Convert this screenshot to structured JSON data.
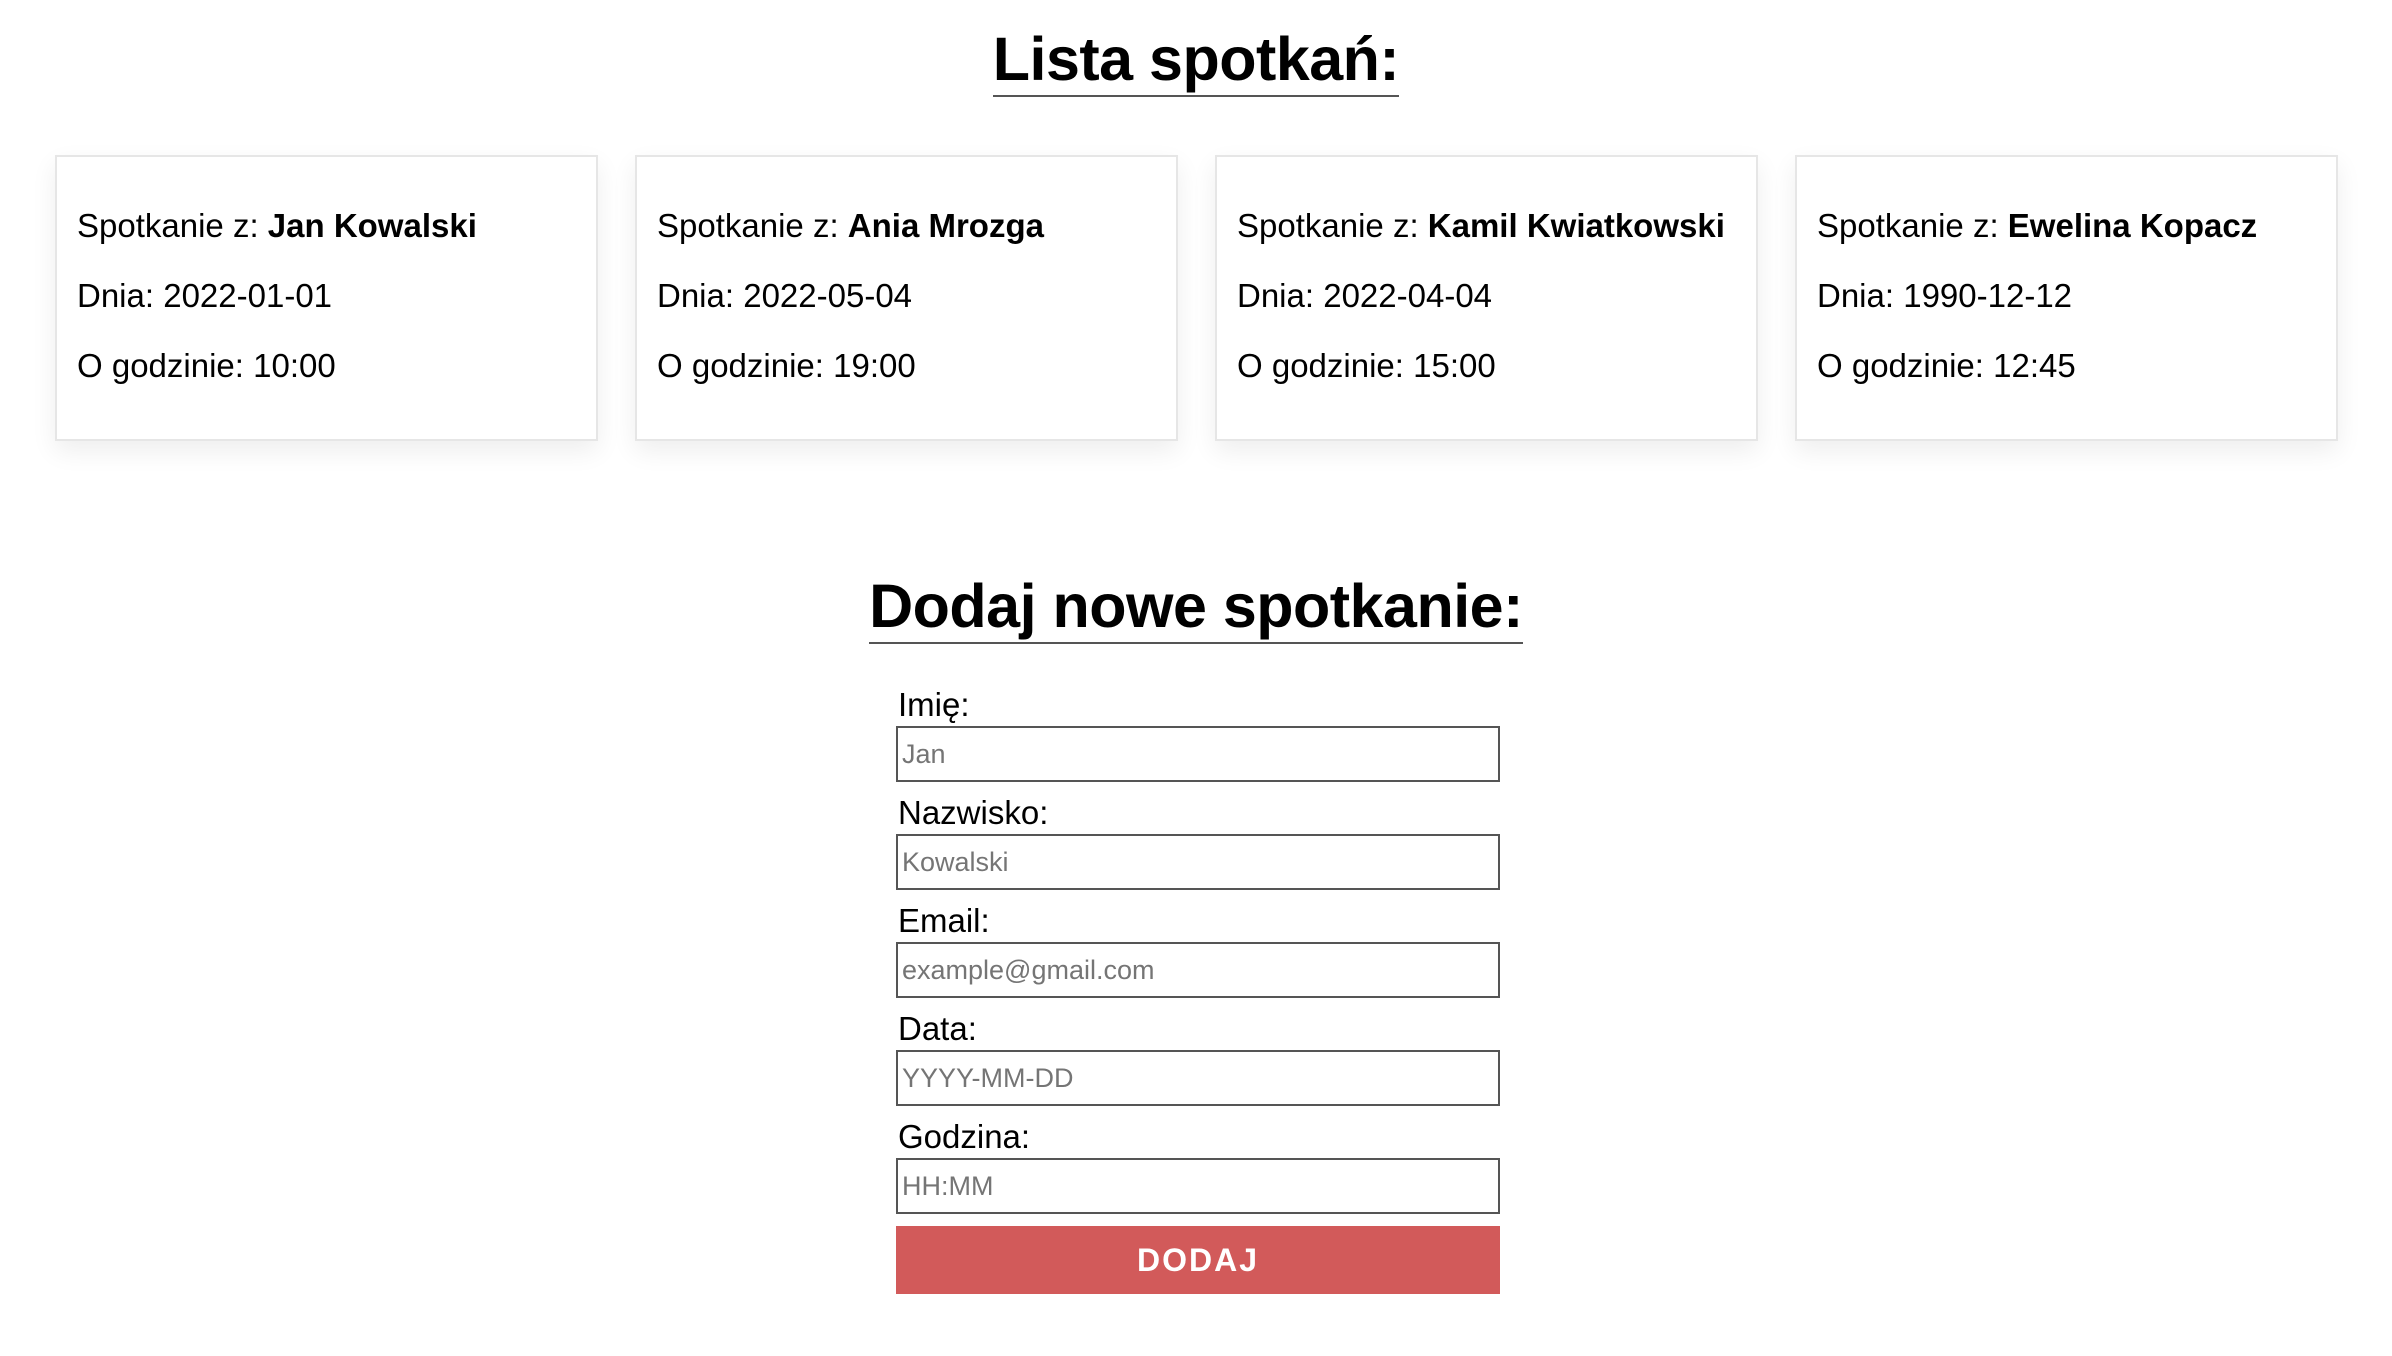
{
  "list_title": "Lista spotkań:",
  "meetings": [
    {
      "prefix": "Spotkanie z: ",
      "name": "Jan Kowalski",
      "date_label": "Dnia: ",
      "date": "2022-01-01",
      "time_label": "O godzinie: ",
      "time": "10:00"
    },
    {
      "prefix": "Spotkanie z: ",
      "name": "Ania Mrozga",
      "date_label": "Dnia: ",
      "date": "2022-05-04",
      "time_label": "O godzinie: ",
      "time": "19:00"
    },
    {
      "prefix": "Spotkanie z: ",
      "name": "Kamil Kwiatkowski",
      "date_label": "Dnia: ",
      "date": "2022-04-04",
      "time_label": "O godzinie: ",
      "time": "15:00"
    },
    {
      "prefix": "Spotkanie z: ",
      "name": "Ewelina Kopacz",
      "date_label": "Dnia: ",
      "date": "1990-12-12",
      "time_label": "O godzinie: ",
      "time": "12:45"
    }
  ],
  "form": {
    "title": "Dodaj nowe spotkanie:",
    "first_name_label": "Imię:",
    "first_name_placeholder": "Jan",
    "last_name_label": "Nazwisko:",
    "last_name_placeholder": "Kowalski",
    "email_label": "Email:",
    "email_placeholder": "example@gmail.com",
    "date_label": "Data:",
    "date_placeholder": "YYYY-MM-DD",
    "time_label": "Godzina:",
    "time_placeholder": "HH:MM",
    "submit_label": "DODAJ"
  },
  "colors": {
    "button_bg": "#d25a5a",
    "card_border": "#e6e6e6"
  }
}
